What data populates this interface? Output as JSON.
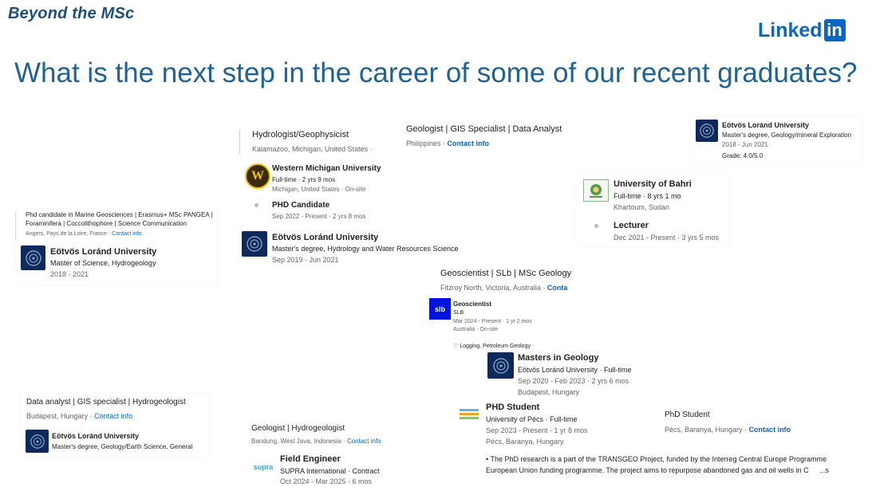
{
  "header": {
    "brand": "Beyond the MSc",
    "linkedin_text": "Linked",
    "linkedin_box": "in",
    "title": "What is the next step in the career of some of our recent graduates?"
  },
  "card1": {
    "headline1": "Phd candidate in Marine Geosciences | Erasmus+ MSc PANGEA |",
    "headline2": "Foraminifera | Coccolithophore | Science Communication",
    "location": "Angers, Pays de la Loire, France · ",
    "contact": "Contact info",
    "school": "Eötvös Loránd University",
    "degree": "Master of Science, Hydrogeology",
    "dates": "2018 - 2021"
  },
  "card2": {
    "headline": "Hydrologist/Geophysicist",
    "location": "Kalamazoo, Michigan, United States ·",
    "org": "Western Michigan University",
    "org_logo": "W",
    "type": "Full-time · 2 yrs 9 mos",
    "org_location": "Michigan, United States · On-site",
    "role": "PHD Candidate",
    "role_dates": "Sep 2022 - Present · 2 yrs 8 mos",
    "school": "Eötvös Loránd University",
    "degree": "Master's degree, Hydrology and Water Resources Science",
    "dates": "Sep 2019 - Jun 2021"
  },
  "card3": {
    "headline": "Geologist | GIS Specialist | Data Analyst",
    "location": "Philippines · ",
    "contact": "Contact info"
  },
  "card4": {
    "school": "Eötvös Loránd University",
    "degree": "Master's degree, Geology/mineral Exploration",
    "dates": "2018 - Jun 2021",
    "grade": "Grade: 4.0/5.0"
  },
  "card5": {
    "org": "University of Bahri",
    "type": "Full-time · 8 yrs 1 mo",
    "location": "Khartoum, Sudan",
    "role": "Lecturer",
    "dates": "Dec 2021 - Present · 3 yrs 5 mos"
  },
  "card6": {
    "headline": "Geoscientist | SLb | MSc Geology",
    "location": "Fitzroy North, Victoria, Australia · ",
    "contact": "Conta",
    "role": "Geoscientist",
    "org": "SLB",
    "org_logo": "slb",
    "dates": "Mar 2024 - Present · 1 yr 2 mos",
    "org_location": "Australia · On-site",
    "skills": "Logging, Petroleum Geology ·",
    "degree_title": "Masters in Geology",
    "school_line": "Eötvös Loránd University · Full-time",
    "school_dates": "Sep 2020 - Feb 2023 · 2 yrs 6 mos",
    "school_location": "Budapest, Hungary"
  },
  "card7": {
    "headline": "Data analyst | GIS specialist | Hydrogeologist",
    "location": "Budapest, Hungary · ",
    "contact": "Contact info",
    "school": "Eötvös Loránd University",
    "degree": "Master's degree, Geology/Earth Science, General"
  },
  "card8": {
    "headline": "Geologist | Hydrogeologist",
    "location": "Bandung, West Java, Indonesia · ",
    "contact": "Contact info",
    "role": "Field Engineer",
    "org_logo": "supra",
    "org": "SUPRA International · Contract",
    "dates": "Oct 2024 - Mar 2025 · 6 mos"
  },
  "card9": {
    "role": "PHD Student",
    "org": "University of Pécs · Full-time",
    "dates": "Sep 2023 - Present · 1 yr 8 mos",
    "location": "Pécs, Baranya, Hungary",
    "desc1": "• The PhD research is a part of the TRANSGEO Project, funded by the Interreg Central Europe Programme",
    "desc2": "European Union funding programme. The project aims to repurpose abandoned gas and oil wells in C",
    "more": "...s",
    "headline": "PhD Student",
    "headline_location": "Pécs, Baranya, Hungary · ",
    "contact": "Contact info"
  },
  "colors": {
    "brand": "#1f4e79",
    "title": "#1f6392",
    "linkedin": "#0a66c2",
    "seal": "#0d2a5c"
  }
}
